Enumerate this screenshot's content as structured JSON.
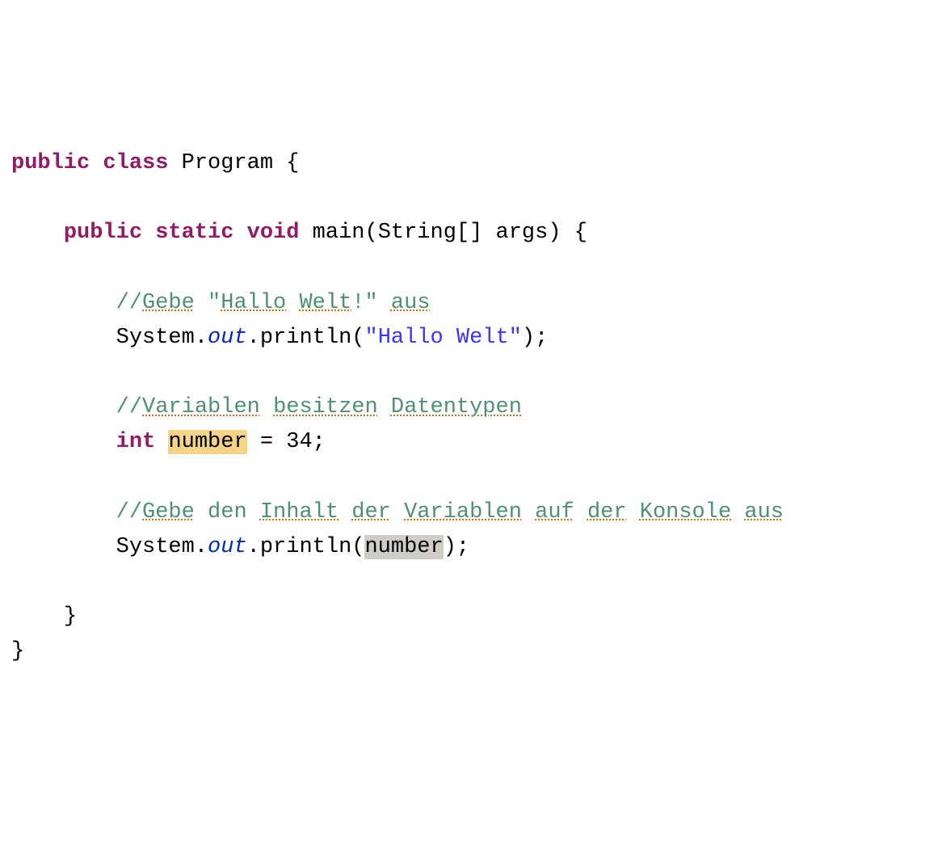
{
  "code": {
    "line1": {
      "kw_public": "public",
      "kw_class": "class",
      "class_name": "Program",
      "brace_open": "{"
    },
    "line2": {
      "kw_public": "public",
      "kw_static": "static",
      "kw_void": "void",
      "method_name": "main",
      "param_type": "String[]",
      "param_name": "args",
      "brace_open": "{"
    },
    "comment1": {
      "prefix": "//",
      "w1": "Gebe",
      "quote_open": "\"",
      "w2": "Hallo",
      "w3": "Welt",
      "excl": "!",
      "quote_close": "\"",
      "w4": "aus"
    },
    "stmt1": {
      "obj": "System",
      "dot1": ".",
      "field": "out",
      "dot2": ".",
      "method": "println",
      "paren_open": "(",
      "str_open": "\"",
      "str_w1": "Hallo",
      "str_w2": "Welt",
      "str_close": "\"",
      "paren_close": ")",
      "semi": ";"
    },
    "comment2": {
      "prefix": "//",
      "w1": "Variablen",
      "w2": "besitzen",
      "w3": "Datentypen"
    },
    "stmt2": {
      "type": "int",
      "var": "number",
      "eq": "=",
      "val": "34",
      "semi": ";"
    },
    "comment3": {
      "prefix": "//",
      "w1": "Gebe",
      "w2": "den",
      "w3": "Inhalt",
      "w4": "der",
      "w5": "Variablen",
      "w6": "auf",
      "w7": "der",
      "w8": "Konsole",
      "w9": "aus"
    },
    "stmt3": {
      "obj": "System",
      "dot1": ".",
      "field": "out",
      "dot2": ".",
      "method": "println",
      "paren_open": "(",
      "arg": "number",
      "paren_close": ")",
      "semi": ";"
    },
    "close_method": "}",
    "close_class": "}"
  }
}
